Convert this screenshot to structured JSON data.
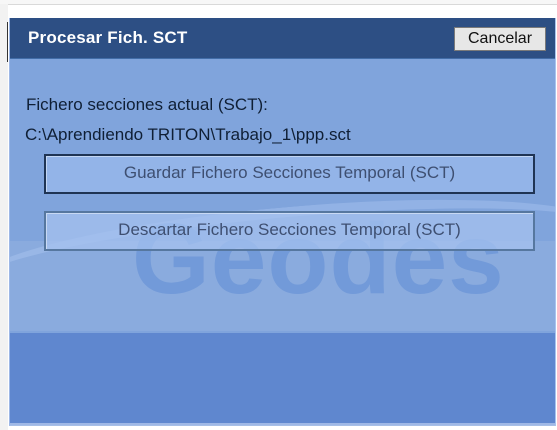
{
  "dialog": {
    "title": "Procesar Fich. SCT",
    "cancel_label": "Cancelar",
    "current_file_label": "Fichero secciones actual (SCT):",
    "current_file_path": "C:\\Aprendiendo TRITON\\Trabajo_1\\ppp.sct",
    "save_button_label": "Guardar Fichero Secciones Temporal (SCT)",
    "discard_button_label": "Descartar Fichero Secciones Temporal (SCT)"
  },
  "watermark": {
    "text": "Geodes"
  },
  "colors": {
    "title_bar": "#2d4f84",
    "dialog_background": "#84a8df",
    "button_text": "#3e4f71",
    "text": "#0f1f35"
  }
}
